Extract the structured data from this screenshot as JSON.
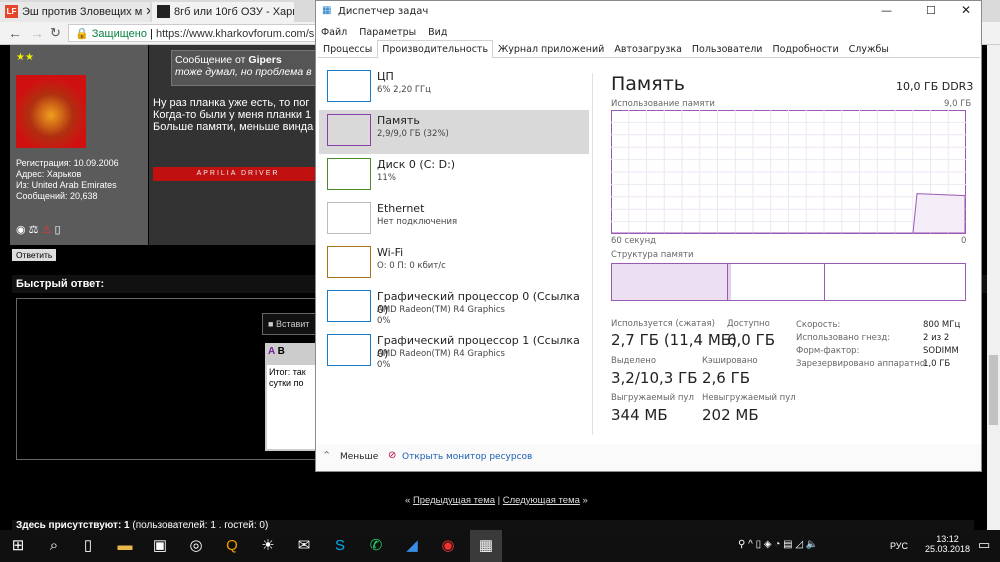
{
  "browser": {
    "tabs": [
      {
        "title": "Эш против Зловещих м",
        "icon": "LF"
      },
      {
        "title": "8гб или 10гб ОЗУ - Харь",
        "icon": "site"
      }
    ],
    "secure_label": "Защищено",
    "url": "https://www.kharkovforum.com/sho"
  },
  "forum": {
    "stars": "★★",
    "user_info": [
      "Регистрация: 10.09.2006",
      "Адрес: Харьков",
      "Из: United Arab Emirates",
      "Сообщений: 20,638"
    ],
    "quote_header": "Сообщение от",
    "quote_author": "Gipers",
    "quote_text": "тоже думал, но проблема в",
    "post_lines": [
      "Ну раз планка уже есть, то пог",
      "Когда-то были у меня планки 1",
      "Больше памяти, меньше винда"
    ],
    "signature": "APRILIA DRIVER",
    "reply_button": "Ответить",
    "quick_reply": "Быстрый ответ:",
    "insert_label": "Вставит",
    "editor_text": [
      "Итог: так",
      "сутки по"
    ],
    "prev_topic": "Предыдущая тема",
    "next_topic": "Следующая тема",
    "present": "Здесь присутствуют: 1",
    "present_detail": "(пользователей: 1 . гостей: 0)"
  },
  "taskmgr": {
    "title": "Диспетчер задач",
    "menu": [
      "Файл",
      "Параметры",
      "Вид"
    ],
    "tabs": [
      "Процессы",
      "Производительность",
      "Журнал приложений",
      "Автозагрузка",
      "Пользователи",
      "Подробности",
      "Службы"
    ],
    "active_tab": 1,
    "resources": [
      {
        "name": "ЦП",
        "sub": "6% 2,20 ГГц",
        "color": "#1a7ac4"
      },
      {
        "name": "Память",
        "sub": "2,9/9,0 ГБ (32%)",
        "color": "#8b3fa8"
      },
      {
        "name": "Диск 0 (C: D:)",
        "sub": "11%",
        "color": "#4d8c2a"
      },
      {
        "name": "Ethernet",
        "sub": "Нет подключения",
        "color": "#bbbbbb"
      },
      {
        "name": "Wi-Fi",
        "sub": "О: 0 П: 0 кбит/с",
        "color": "#a7741b"
      },
      {
        "name": "Графический процессор 0 (Ссылка 0)",
        "sub": "AMD Radeon(TM) R4 Graphics",
        "sub2": "0%",
        "color": "#1a7ac4"
      },
      {
        "name": "Графический процессор 1 (Ссылка 0)",
        "sub": "AMD Radeon(TM) R4 Graphics",
        "sub2": "0%",
        "color": "#1a7ac4"
      }
    ],
    "selected": 1,
    "heading": "Память",
    "capacity": "10,0 ГБ DDR3",
    "usage_label": "Использование памяти",
    "usage_max": "9,0 ГБ",
    "time_left": "60 секунд",
    "time_right": "0",
    "structure_label": "Структура памяти",
    "stats": {
      "in_use_label": "Используется (сжатая)",
      "in_use": "2,7 ГБ (11,4 МБ)",
      "available_label": "Доступно",
      "available": "6,0 ГБ",
      "committed_label": "Выделено",
      "committed": "3,2/10,3 ГБ",
      "cached_label": "Кэшировано",
      "cached": "2,6 ГБ",
      "paged_label": "Выгружаемый пул",
      "paged": "344 МБ",
      "nonpaged_label": "Невыгружаемый пул",
      "nonpaged": "202 МБ"
    },
    "specs": [
      {
        "k": "Скорость:",
        "v": "800 МГц"
      },
      {
        "k": "Использовано гнезд:",
        "v": "2 из 2"
      },
      {
        "k": "Форм-фактор:",
        "v": "SODIMM"
      },
      {
        "k": "Зарезервировано аппаратно:",
        "v": "1,0 ГБ"
      }
    ],
    "fewer": "Меньше",
    "open_monitor": "Открыть монитор ресурсов",
    "usage_fraction": 0.32
  },
  "tray": {
    "lang": "РУС",
    "time": "13:12",
    "date": "25.03.2018"
  }
}
